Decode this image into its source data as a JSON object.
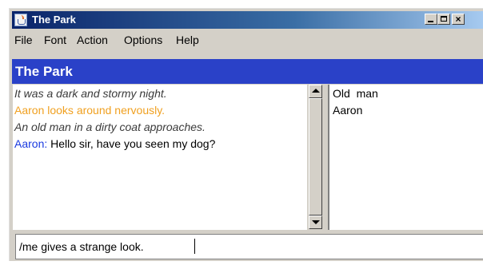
{
  "window": {
    "title": "The Park",
    "icon": "java-cup-icon",
    "controls": [
      "minimize-icon",
      "maximize-icon",
      "close-icon"
    ]
  },
  "menu": {
    "items": [
      "File",
      "Font",
      "Action",
      "Options",
      "Help"
    ]
  },
  "header": {
    "title": "The Park"
  },
  "chat": {
    "line1": "It was a dark and stormy night.",
    "line2": "Aaron looks around nervously.",
    "line3": "An old man in a dirty coat approaches.",
    "line4_speaker": "Aaron",
    "line4_sep": ": ",
    "line4_text": "Hello sir, have you seen my dog?"
  },
  "users": [
    "Old  man",
    "Aaron"
  ],
  "input": {
    "value": "/me gives a strange look."
  },
  "colors": {
    "header_bg": "#2a41c8",
    "narration": "#3a3a3a",
    "action": "#f0a020",
    "speaker": "#1a3ae0"
  }
}
